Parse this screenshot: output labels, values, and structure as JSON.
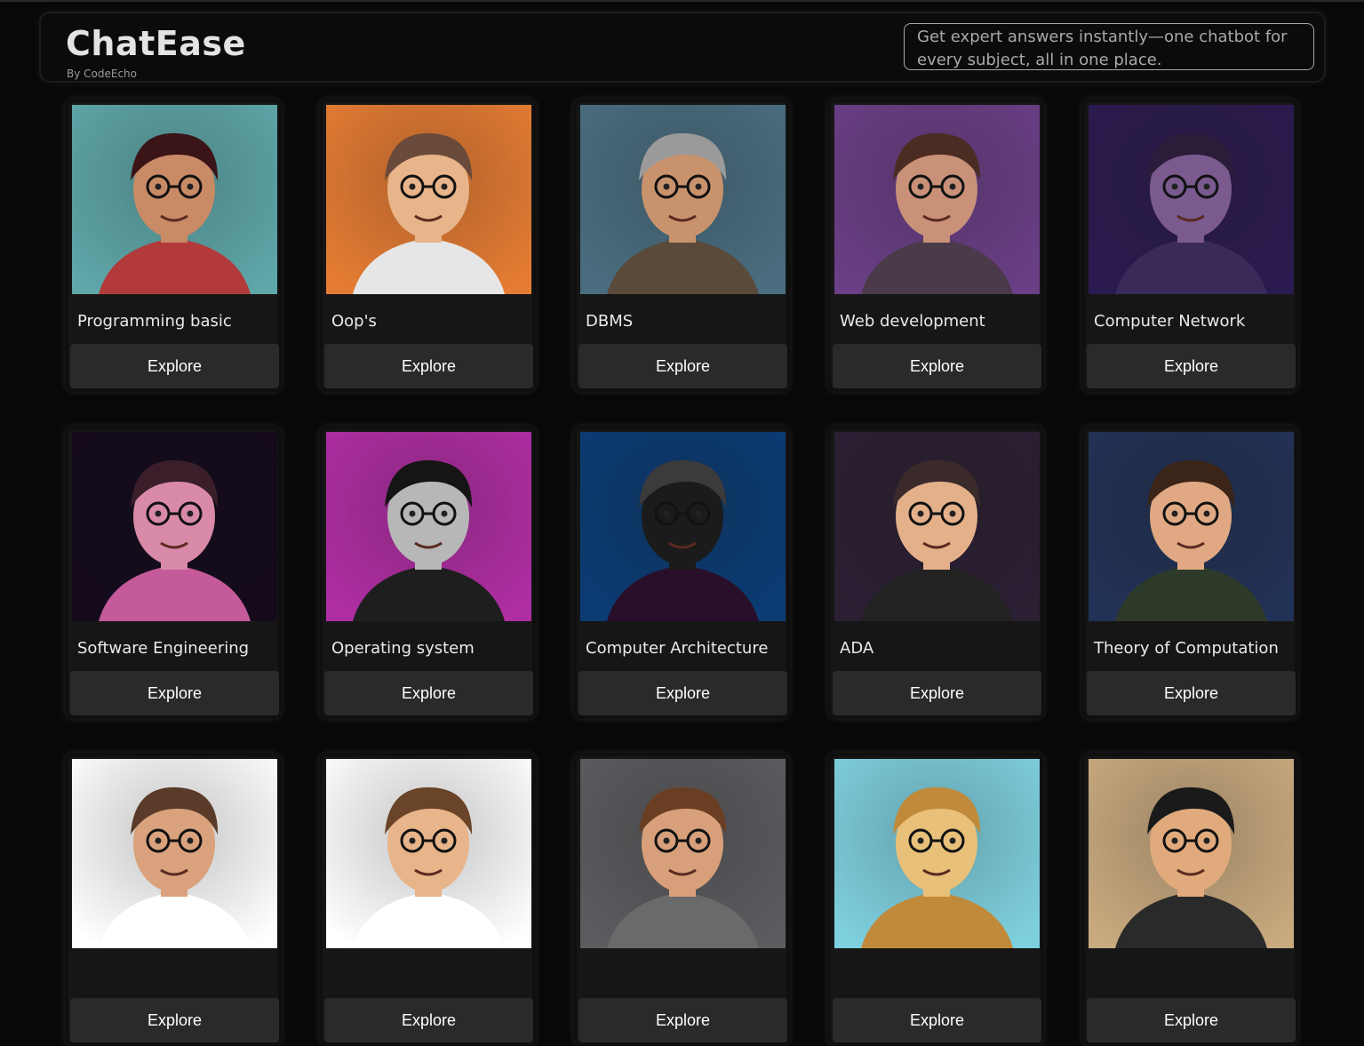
{
  "header": {
    "title": "ChatEase",
    "subtitle": "By CodeEcho",
    "tagline": "Get expert answers instantly—one chatbot for every subject, all in one place."
  },
  "cards": [
    {
      "title": "Programming basic",
      "button": "Explore",
      "bg": "#5fa7a9"
    },
    {
      "title": "Oop's",
      "button": "Explore",
      "bg": "#e57c33"
    },
    {
      "title": "DBMS",
      "button": "Explore",
      "bg": "#4a6e80"
    },
    {
      "title": "Web development",
      "button": "Explore",
      "bg": "#6a3f86"
    },
    {
      "title": "Computer Network",
      "button": "Explore",
      "bg": "#2b1a4f"
    },
    {
      "title": "Software Engineering",
      "button": "Explore",
      "bg": "#140a1c"
    },
    {
      "title": "Operating system",
      "button": "Explore",
      "bg": "#b02ea3"
    },
    {
      "title": "Computer Architecture",
      "button": "Explore",
      "bg": "#0b3c74"
    },
    {
      "title": "ADA",
      "button": "Explore",
      "bg": "#2b1f33"
    },
    {
      "title": "Theory of Computation",
      "button": "Explore",
      "bg": "#223256"
    },
    {
      "title": "",
      "button": "Explore",
      "bg": "#ffffff"
    },
    {
      "title": "",
      "button": "Explore",
      "bg": "#ffffff"
    },
    {
      "title": "",
      "button": "Explore",
      "bg": "#5c5c60"
    },
    {
      "title": "",
      "button": "Explore",
      "bg": "#7fd0df"
    },
    {
      "title": "",
      "button": "Explore",
      "bg": "#c9aa7f"
    }
  ]
}
